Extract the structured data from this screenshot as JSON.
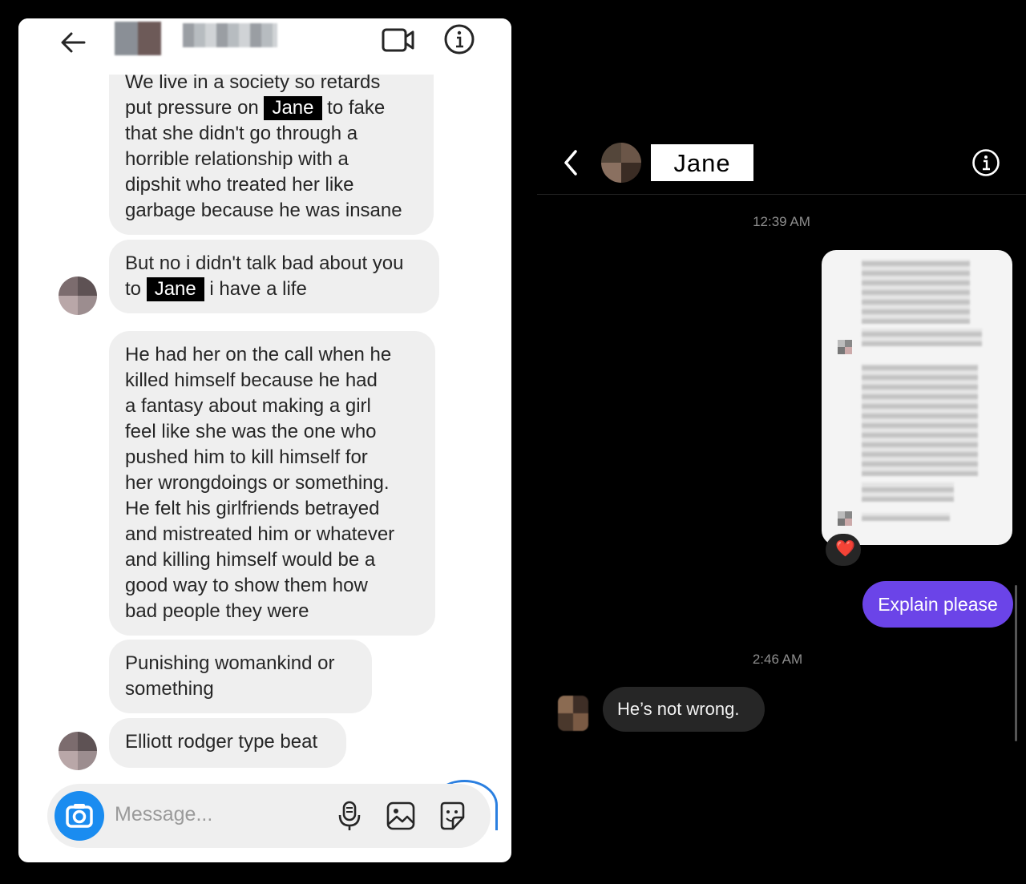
{
  "left_panel": {
    "header": {
      "back_icon": "arrow-left-icon",
      "video_icon": "video-call-icon",
      "info_icon": "info-icon"
    },
    "messages": [
      {
        "lines": [
          "We live in a society so retards",
          "put pressure on",
          "to fake",
          "that she didn't go through a",
          "horrible relationship with a",
          "dipshit who treated her like",
          "garbage because he was insane"
        ],
        "redacted_name": "Jane"
      },
      {
        "line1_prefix": "But no i didn't talk bad about you",
        "line2_prefix": "to",
        "line2_suffix": "i have a life",
        "redacted_name": "Jane"
      },
      {
        "lines": [
          "He had her on the call when he",
          "killed himself because he had",
          "a fantasy about making a girl",
          "feel like she was the one who",
          "pushed him to kill himself for",
          "her wrongdoings or something.",
          "He felt his girlfriends betrayed",
          "and mistreated him or whatever",
          "and killing himself would be a",
          "good way to show them how",
          "bad people they were"
        ]
      },
      {
        "lines": [
          "Punishing womankind or",
          "something"
        ]
      },
      {
        "lines": [
          "Elliott rodger type beat"
        ]
      }
    ],
    "composer": {
      "placeholder": "Message...",
      "camera_icon": "camera-icon",
      "mic_icon": "microphone-icon",
      "gallery_icon": "image-icon",
      "sticker_icon": "sticker-icon"
    }
  },
  "right_panel": {
    "header": {
      "contact_name": "Jane",
      "back_icon": "chevron-left-icon",
      "info_icon": "info-icon"
    },
    "timestamp_1": "12:39 AM",
    "reaction": "❤️",
    "sent_message": "Explain please",
    "timestamp_2": "2:46 AM",
    "received_message": "He’s not wrong."
  },
  "colors": {
    "sent_bubble": "#6b44e8",
    "received_bubble_dark": "#262626",
    "received_bubble_light": "#efefef",
    "camera_button": "#1a8cf0"
  }
}
